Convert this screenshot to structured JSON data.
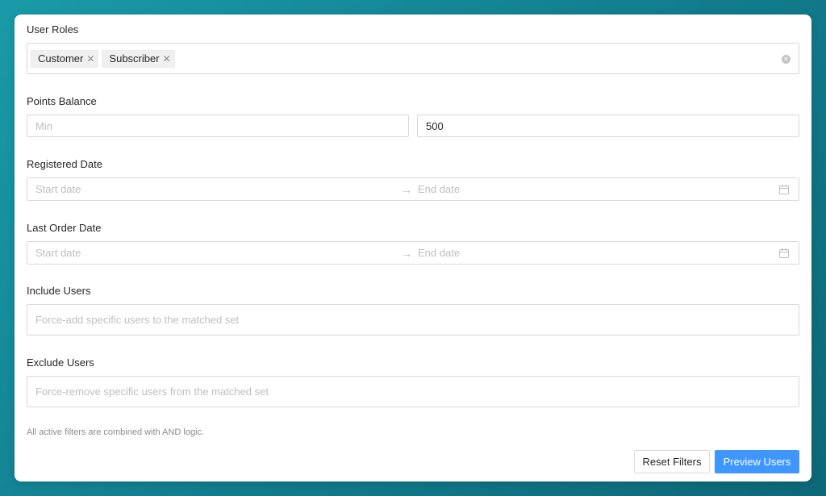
{
  "user_roles": {
    "label": "User Roles",
    "tags": [
      "Customer",
      "Subscriber"
    ]
  },
  "points_balance": {
    "label": "Points Balance",
    "min_placeholder": "Min",
    "max_value": "500"
  },
  "registered_date": {
    "label": "Registered Date",
    "start_placeholder": "Start date",
    "end_placeholder": "End date"
  },
  "last_order_date": {
    "label": "Last Order Date",
    "start_placeholder": "Start date",
    "end_placeholder": "End date"
  },
  "include_users": {
    "label": "Include Users",
    "placeholder": "Force-add specific users to the matched set"
  },
  "exclude_users": {
    "label": "Exclude Users",
    "placeholder": "Force-remove specific users from the matched set"
  },
  "note": "All active filters are combined with AND logic.",
  "actions": {
    "reset_label": "Reset Filters",
    "preview_label": "Preview Users"
  },
  "icons": {
    "tag_close": "close-icon",
    "clear": "clear-circle-icon",
    "arrow": "arrow-right-icon",
    "calendar": "calendar-icon"
  },
  "colors": {
    "primary": "#4096ff",
    "placeholder": "#bfbfbf",
    "border": "#d9d9d9"
  }
}
